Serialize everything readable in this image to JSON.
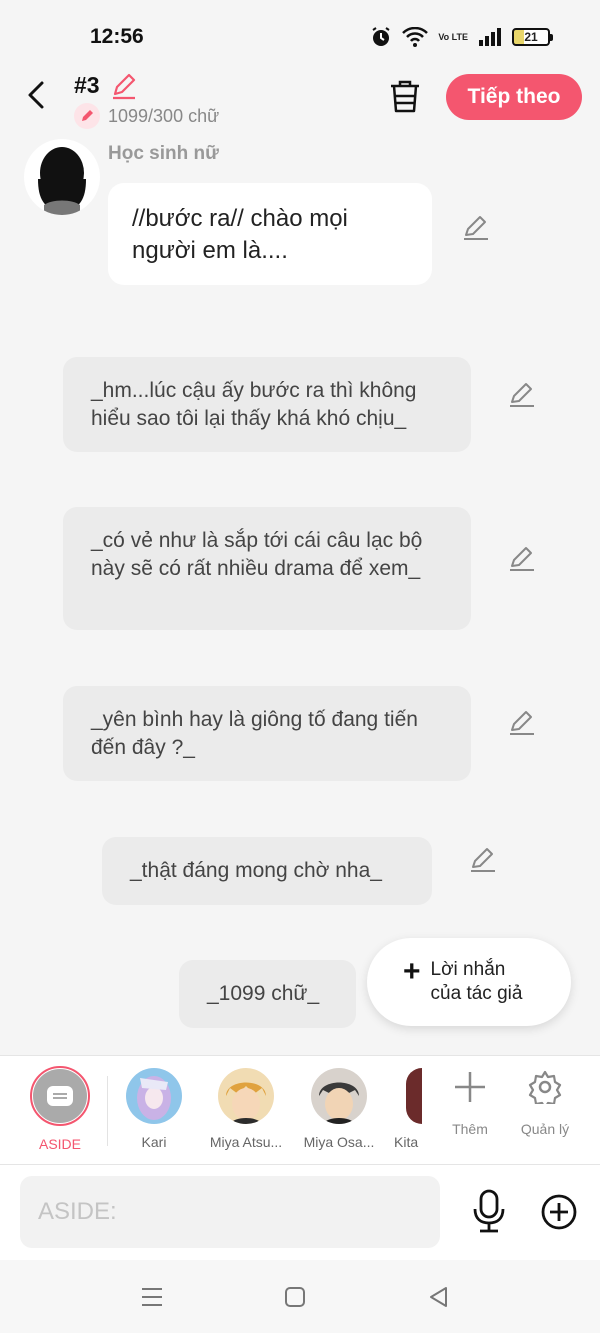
{
  "status_bar": {
    "time": "12:56",
    "battery": "21",
    "network": "Vo LTE"
  },
  "header": {
    "episode": "#3",
    "word_count": "1099/300 chữ",
    "next_label": "Tiếp theo",
    "accent_color": "#f4566f"
  },
  "chat": {
    "character_name": "Học sinh nữ",
    "messages": [
      {
        "text": "//bước ra// chào mọi người em là...."
      },
      {
        "text": "_hm...lúc cậu ấy bước ra thì không hiểu sao tôi lại thấy khá khó chịu_"
      },
      {
        "text": "_có vẻ như là sắp tới cái câu lạc bộ này sẽ có rất nhiều drama để xem_"
      },
      {
        "text": "_yên bình hay là giông tố đang tiến đến đây ?_"
      },
      {
        "text": "_thật đáng mong chờ nha_"
      },
      {
        "text": "_1099 chữ_"
      }
    ],
    "author_note_label": "Lời nhắn của tác giả"
  },
  "characters": [
    {
      "label": "ASIDE",
      "selected": true
    },
    {
      "label": "Kari"
    },
    {
      "label": "Miya Atsu..."
    },
    {
      "label": "Miya Osa..."
    },
    {
      "label": "Kita"
    }
  ],
  "tools": {
    "add_label": "Thêm",
    "manage_label": "Quản lý"
  },
  "input": {
    "placeholder": "ASIDE:"
  }
}
